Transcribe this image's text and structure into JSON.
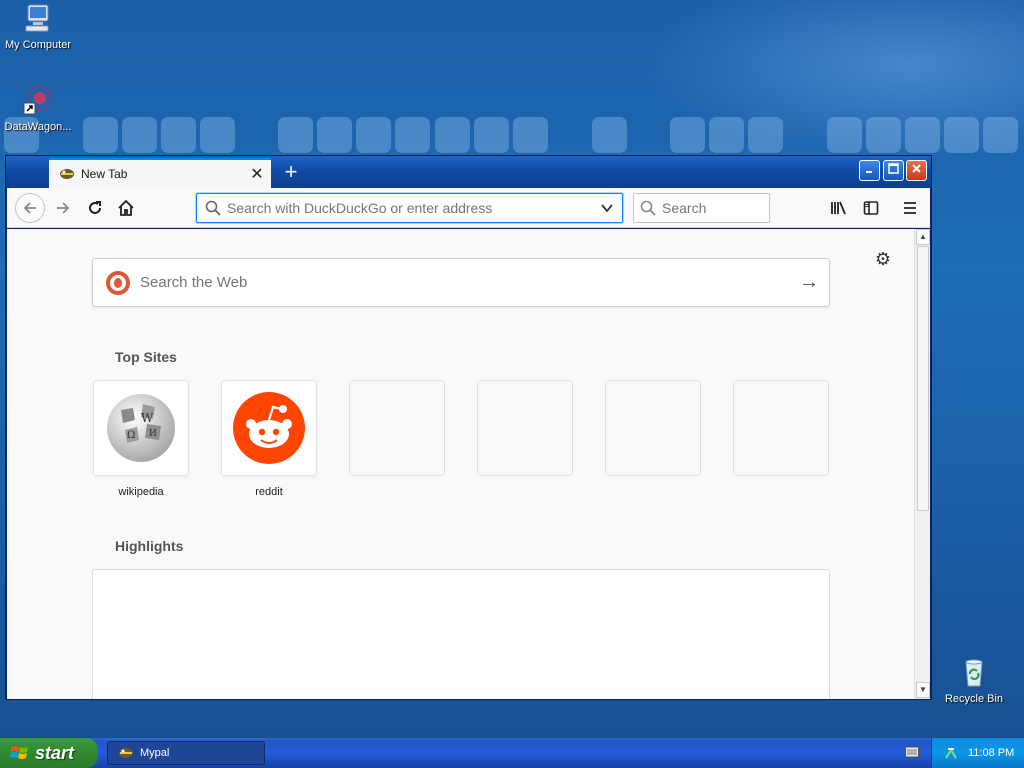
{
  "desktop": {
    "icons": [
      {
        "label": "My Computer"
      },
      {
        "label": "DataWagon..."
      },
      {
        "label": "Recycle Bin"
      }
    ]
  },
  "browser": {
    "tab": {
      "title": "New Tab"
    },
    "urlbar": {
      "placeholder": "Search with DuckDuckGo or enter address"
    },
    "searchbar": {
      "placeholder": "Search"
    },
    "page": {
      "websearch_placeholder": "Search the Web",
      "top_sites_title": "Top Sites",
      "top_sites": [
        {
          "label": "wikipedia",
          "icon": "wikipedia-globe-icon"
        },
        {
          "label": "reddit",
          "icon": "reddit-alien-icon"
        },
        {
          "label": ""
        },
        {
          "label": ""
        },
        {
          "label": ""
        },
        {
          "label": ""
        }
      ],
      "highlights_title": "Highlights"
    },
    "accent_color": "#0a84ff"
  },
  "taskbar": {
    "start_label": "start",
    "task_label": "Mypal",
    "clock": "11:08 PM"
  }
}
